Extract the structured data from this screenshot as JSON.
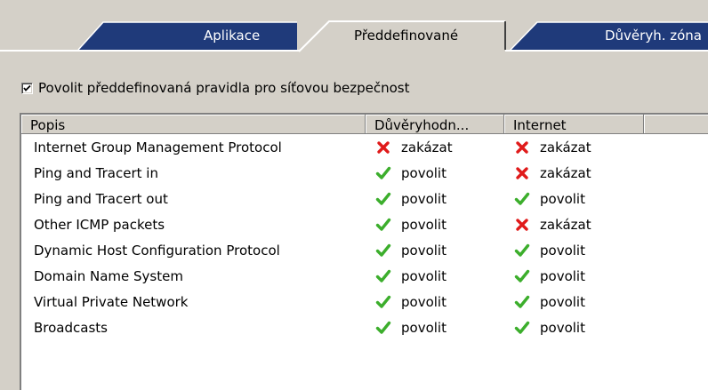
{
  "tabs": [
    {
      "label": "Aplikace",
      "active": false
    },
    {
      "label": "Předdefinované",
      "active": true
    },
    {
      "label": "Důvěryh. zóna",
      "active": false
    }
  ],
  "checkbox": {
    "label": "Povolit předdefinovaná pravidla pro síťovou bezpečnost",
    "checked": true
  },
  "table": {
    "columns": [
      "Popis",
      "Důvěryhodn...",
      "Internet",
      ""
    ],
    "rows": [
      {
        "popis": "Internet Group Management Protocol",
        "trusted": {
          "icon": "cross",
          "text": "zakázat"
        },
        "internet": {
          "icon": "cross",
          "text": "zakázat"
        }
      },
      {
        "popis": "Ping and Tracert in",
        "trusted": {
          "icon": "check",
          "text": "povolit"
        },
        "internet": {
          "icon": "cross",
          "text": "zakázat"
        }
      },
      {
        "popis": "Ping and Tracert out",
        "trusted": {
          "icon": "check",
          "text": "povolit"
        },
        "internet": {
          "icon": "check",
          "text": "povolit"
        }
      },
      {
        "popis": "Other ICMP packets",
        "trusted": {
          "icon": "check",
          "text": "povolit"
        },
        "internet": {
          "icon": "cross",
          "text": "zakázat"
        }
      },
      {
        "popis": "Dynamic Host Configuration Protocol",
        "trusted": {
          "icon": "check",
          "text": "povolit"
        },
        "internet": {
          "icon": "check",
          "text": "povolit"
        }
      },
      {
        "popis": "Domain Name System",
        "trusted": {
          "icon": "check",
          "text": "povolit"
        },
        "internet": {
          "icon": "check",
          "text": "povolit"
        }
      },
      {
        "popis": "Virtual Private Network",
        "trusted": {
          "icon": "check",
          "text": "povolit"
        },
        "internet": {
          "icon": "check",
          "text": "povolit"
        }
      },
      {
        "popis": "Broadcasts",
        "trusted": {
          "icon": "check",
          "text": "povolit"
        },
        "internet": {
          "icon": "check",
          "text": "povolit"
        }
      }
    ]
  },
  "colors": {
    "tab_dark": "#1f3a7a",
    "check": "#3cae2c",
    "cross": "#e01a1a"
  }
}
